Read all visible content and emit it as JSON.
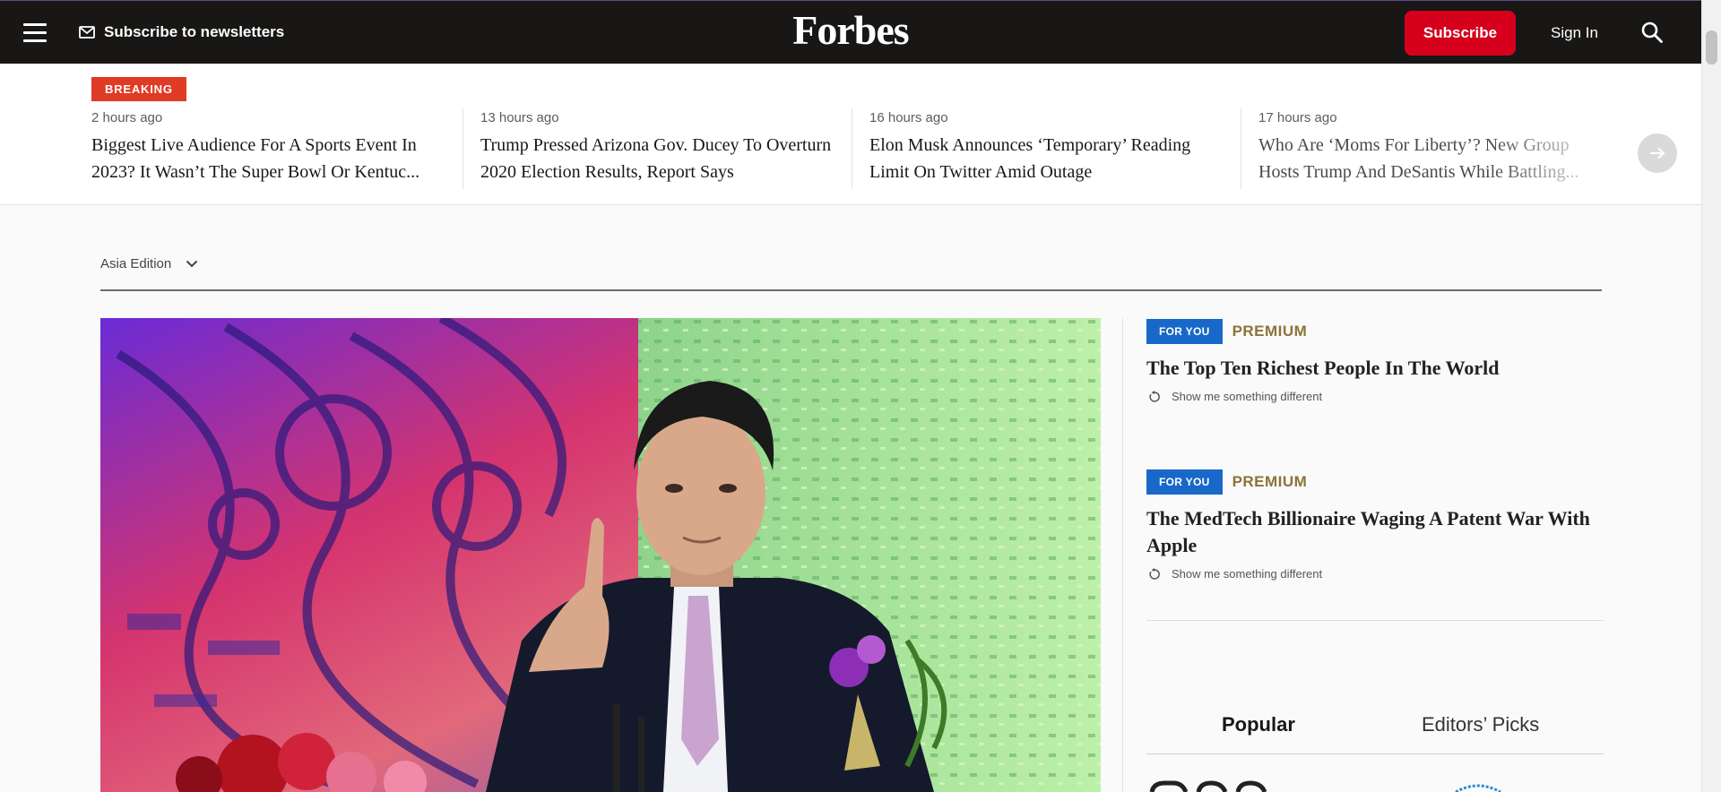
{
  "header": {
    "newsletter_label": "Subscribe to newsletters",
    "logo_text": "Forbes",
    "subscribe_label": "Subscribe",
    "signin_label": "Sign In"
  },
  "breaking": {
    "badge": "BREAKING",
    "items": [
      {
        "time": "2 hours ago",
        "title": "Biggest Live Audience For A Sports Event In 2023? It Wasn’t The Super Bowl Or Kentuc..."
      },
      {
        "time": "13 hours ago",
        "title": "Trump Pressed Arizona Gov. Ducey To Overturn 2020 Election Results, Report Says"
      },
      {
        "time": "16 hours ago",
        "title": "Elon Musk Announces ‘Temporary’ Reading Limit On Twitter Amid Outage"
      },
      {
        "time": "17 hours ago",
        "title": "Who Are ‘Moms For Liberty’? New Group Hosts Trump And DeSantis While Battling..."
      }
    ]
  },
  "edition": {
    "label": "Asia Edition"
  },
  "rail": {
    "cards": [
      {
        "tag": "FOR YOU",
        "premium": "PREMIUM",
        "title": "The Top Ten Richest People In The World",
        "action": "Show me something different"
      },
      {
        "tag": "FOR YOU",
        "premium": "PREMIUM",
        "title": "The MedTech Billionaire Waging A Patent War With Apple",
        "action": "Show me something different"
      }
    ],
    "tabs": [
      {
        "label": "Popular",
        "active": true
      },
      {
        "label": "Editors’ Picks",
        "active": false
      }
    ]
  },
  "icons": {
    "menu": "hamburger-menu-icon",
    "newsletter": "envelope-icon",
    "search": "search-icon",
    "next": "arrow-right-icon",
    "edition": "chevron-down-icon",
    "refresh": "refresh-icon"
  },
  "colors": {
    "header_bg": "#181716",
    "subscribe_bg": "#d6001c",
    "breaking_bg": "#e03b25",
    "for_you_bg": "#1868c9",
    "premium_text": "#8b7338"
  }
}
